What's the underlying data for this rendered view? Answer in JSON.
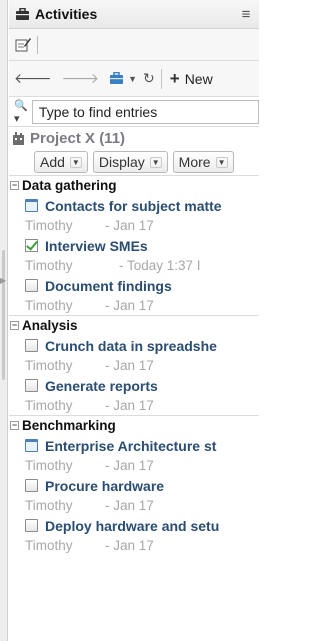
{
  "window": {
    "title": "Activities"
  },
  "toolbar": {
    "new_label": "New"
  },
  "search": {
    "placeholder": "Type to find entries"
  },
  "project": {
    "title": "Project X (11)"
  },
  "actions": {
    "add": "Add",
    "display": "Display",
    "more": "More"
  },
  "groups": [
    {
      "label": "Data gathering",
      "entries": [
        {
          "icon": "meeting-icon",
          "title": "Contacts for subject matte",
          "owner": "Timothy",
          "date": "- Jan 17"
        },
        {
          "icon": "completed-check-icon",
          "title": "Interview SMEs",
          "owner": "Timothy",
          "date": "- Today 1:37 I"
        },
        {
          "icon": "checkbox-icon",
          "title": "Document findings",
          "owner": "Timothy",
          "date": "- Jan 17"
        }
      ]
    },
    {
      "label": "Analysis",
      "entries": [
        {
          "icon": "checkbox-icon",
          "title": "Crunch data in spreadshe",
          "owner": "Timothy",
          "date": "- Jan 17"
        },
        {
          "icon": "checkbox-icon",
          "title": "Generate reports",
          "owner": "Timothy",
          "date": "- Jan 17"
        }
      ]
    },
    {
      "label": "Benchmarking",
      "entries": [
        {
          "icon": "meeting-icon",
          "title": "Enterprise Architecture st",
          "owner": "Timothy",
          "date": "- Jan 17"
        },
        {
          "icon": "checkbox-icon",
          "title": "Procure hardware",
          "owner": "Timothy",
          "date": "- Jan 17"
        },
        {
          "icon": "checkbox-icon",
          "title": "Deploy hardware and setu",
          "owner": "Timothy",
          "date": "- Jan 17"
        }
      ]
    }
  ],
  "colors": {
    "entry_title": "#2a4d72",
    "project_title": "#7b7b86",
    "meta_text": "#a8a8a8",
    "briefcase": "#3a7fc4"
  }
}
